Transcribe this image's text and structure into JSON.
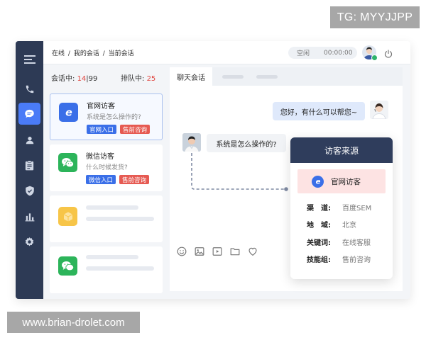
{
  "watermarks": {
    "tg": "TG: MYYJJPP",
    "site": "www.brian-drolet.com"
  },
  "topbar": {
    "breadcrumb": [
      "在线",
      "我的会话",
      "当前会话"
    ],
    "separator": "/",
    "status": "空闲",
    "timer": "00:00:00"
  },
  "sidebar": {
    "items": [
      "menu-icon",
      "phone-icon",
      "chat-icon",
      "user-icon",
      "clipboard-icon",
      "shield-icon",
      "bar-chart-icon",
      "gear-icon"
    ],
    "active": "chat-icon",
    "colors": {
      "bg": "#2d3a55",
      "active": "#4a7bf7"
    }
  },
  "queue": {
    "in_session_label": "会话中:",
    "in_session": "14",
    "divider": "|",
    "in_session_max": "99",
    "waiting_label": "排队中:",
    "waiting": "25"
  },
  "sessions": [
    {
      "title": "官网访客",
      "message": "系统是怎么操作的?",
      "tags": [
        "官网入口",
        "售前咨询"
      ],
      "icon": "ie-icon",
      "color": "#3a6fe8"
    },
    {
      "title": "微信访客",
      "message": "什么时候发货?",
      "tags": [
        "微信入口",
        "售前咨询"
      ],
      "icon": "wechat-icon",
      "color": "#2cb45a"
    }
  ],
  "chat": {
    "tab": "聊天会话",
    "agent_message": "您好，有什么可以帮您~",
    "visitor_message": "系统是怎么操作的?",
    "toolbar_icons": [
      "smile-icon",
      "image-icon",
      "video-icon",
      "folder-icon",
      "heart-icon"
    ]
  },
  "visitor_source": {
    "header": "访客来源",
    "source": "官网访客",
    "rows": [
      {
        "key": "渠　道:",
        "value": "百度SEM"
      },
      {
        "key": "地　域:",
        "value": "北京"
      },
      {
        "key": "关键词:",
        "value": "在线客服"
      },
      {
        "key": "技能组:",
        "value": "售前咨询"
      }
    ]
  }
}
